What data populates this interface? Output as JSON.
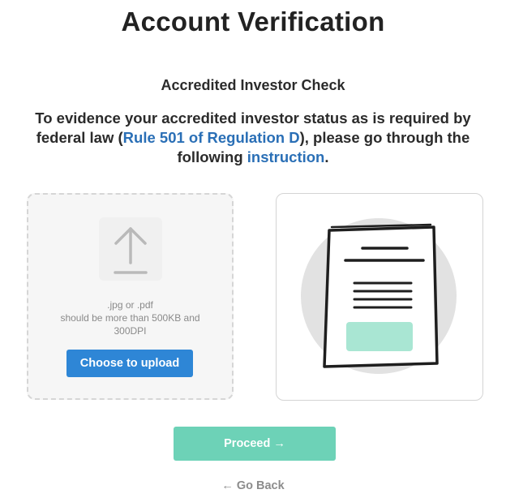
{
  "page": {
    "title": "Account Verification",
    "subtitle": "Accredited Investor Check"
  },
  "description": {
    "part1": "To evidence your accredited investor status as is required by federal law (",
    "link_regulation": "Rule 501 of Regulation D",
    "part2": "), please go through the following ",
    "link_instruction": "instruction",
    "part3": "."
  },
  "upload": {
    "formats": ".jpg or .pdf",
    "requirement_line1": "should be more than 500KB and",
    "requirement_line2": "300DPI",
    "button_label": "Choose to upload",
    "icon": "upload-arrow-icon"
  },
  "illustration": {
    "icon": "document-icon"
  },
  "actions": {
    "proceed_label": "Proceed →",
    "go_back_label": "← Go Back"
  },
  "colors": {
    "link": "#2a6fb6",
    "upload_button": "#2e86d6",
    "proceed_button": "#6dd2b7",
    "document_accent": "#a9e6d3",
    "circle_bg": "#e2e2e2"
  }
}
